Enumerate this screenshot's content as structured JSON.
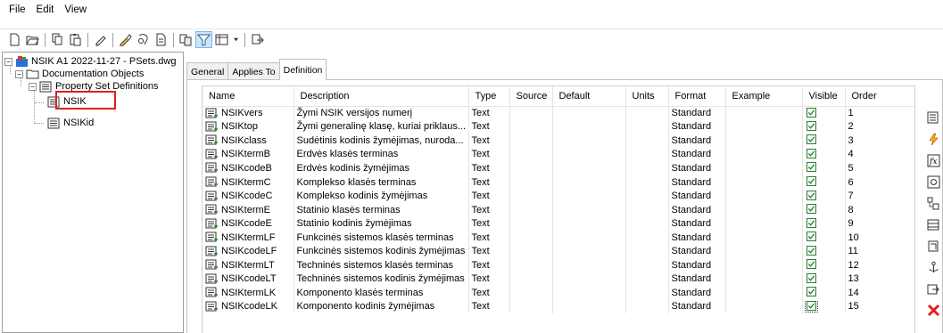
{
  "menu": [
    "File",
    "Edit",
    "View"
  ],
  "toolbar": {
    "icons": [
      "new-icon",
      "open-icon",
      "copy-icon",
      "paste-icon",
      "edit-icon",
      "rename-icon",
      "purge-icon",
      "properties-icon",
      "import-icon",
      "filter-icon",
      "view-options-icon",
      "export-icon"
    ]
  },
  "tree": {
    "root": "NSIK A1 2022-11-27 - PSets.dwg",
    "doc_objects": "Documentation Objects",
    "psd": "Property Set Definitions",
    "items": [
      "NSIK",
      "NSIKid"
    ]
  },
  "tabs": [
    "General",
    "Applies To",
    "Definition"
  ],
  "active_tab": "Definition",
  "columns": [
    "Name",
    "Description",
    "Type",
    "Source",
    "Default",
    "Units",
    "Format",
    "Example",
    "Visible",
    "Order"
  ],
  "rows": [
    {
      "name": "NSIKvers",
      "description": "Žymi NSIK versijos numerį",
      "type": "Text",
      "format": "Standard",
      "order": "1"
    },
    {
      "name": "NSIKtop",
      "description": "Žymi generalinę klasę, kuriai priklaus...",
      "type": "Text",
      "format": "Standard",
      "order": "2"
    },
    {
      "name": "NSIKclass",
      "description": "Sudėtinis kodinis žymėjimas, nuroda...",
      "type": "Text",
      "format": "Standard",
      "order": "3"
    },
    {
      "name": "NSIKtermB",
      "description": "Erdvės klasės terminas",
      "type": "Text",
      "format": "Standard",
      "order": "4"
    },
    {
      "name": "NSIKcodeB",
      "description": "Erdvės kodinis žymėjimas",
      "type": "Text",
      "format": "Standard",
      "order": "5"
    },
    {
      "name": "NSIKtermC",
      "description": "Komplekso klasės terminas",
      "type": "Text",
      "format": "Standard",
      "order": "6"
    },
    {
      "name": "NSIKcodeC",
      "description": "Komplekso kodinis žymėjimas",
      "type": "Text",
      "format": "Standard",
      "order": "7"
    },
    {
      "name": "NSIKtermE",
      "description": "Statinio klasės terminas",
      "type": "Text",
      "format": "Standard",
      "order": "8"
    },
    {
      "name": "NSIKcodeE",
      "description": "Statinio kodinis žymėjimas",
      "type": "Text",
      "format": "Standard",
      "order": "9"
    },
    {
      "name": "NSIKtermLF",
      "description": "Funkcinės sistemos klasės terminas",
      "type": "Text",
      "format": "Standard",
      "order": "10"
    },
    {
      "name": "NSIKcodeLF",
      "description": "Funkcinės sistemos kodinis žymėjimas",
      "type": "Text",
      "format": "Standard",
      "order": "11"
    },
    {
      "name": "NSIKtermLT",
      "description": "Techninės sistemos klasės terminas",
      "type": "Text",
      "format": "Standard",
      "order": "12"
    },
    {
      "name": "NSIKcodeLT",
      "description": "Techninės sistemos kodinis žymėjimas",
      "type": "Text",
      "format": "Standard",
      "order": "13"
    },
    {
      "name": "NSIKtermLK",
      "description": "Komponento klasės terminas",
      "type": "Text",
      "format": "Standard",
      "order": "14"
    },
    {
      "name": "NSIKcodeLK",
      "description": "Komponento kodinis žymėjimas",
      "type": "Text",
      "format": "Standard",
      "order": "15"
    }
  ],
  "side_buttons": [
    "add-property-icon",
    "add-automatic-property-icon",
    "add-formula-property-icon",
    "add-location-property-icon",
    "add-classification-property-icon",
    "add-material-property-icon",
    "add-graphic-property-icon",
    "add-anchor-property-icon",
    "add-project-property-icon",
    "delete-icon"
  ],
  "colors": {
    "selection_border": "#e02020",
    "check": "#2e7d32",
    "delete": "#e02020"
  }
}
